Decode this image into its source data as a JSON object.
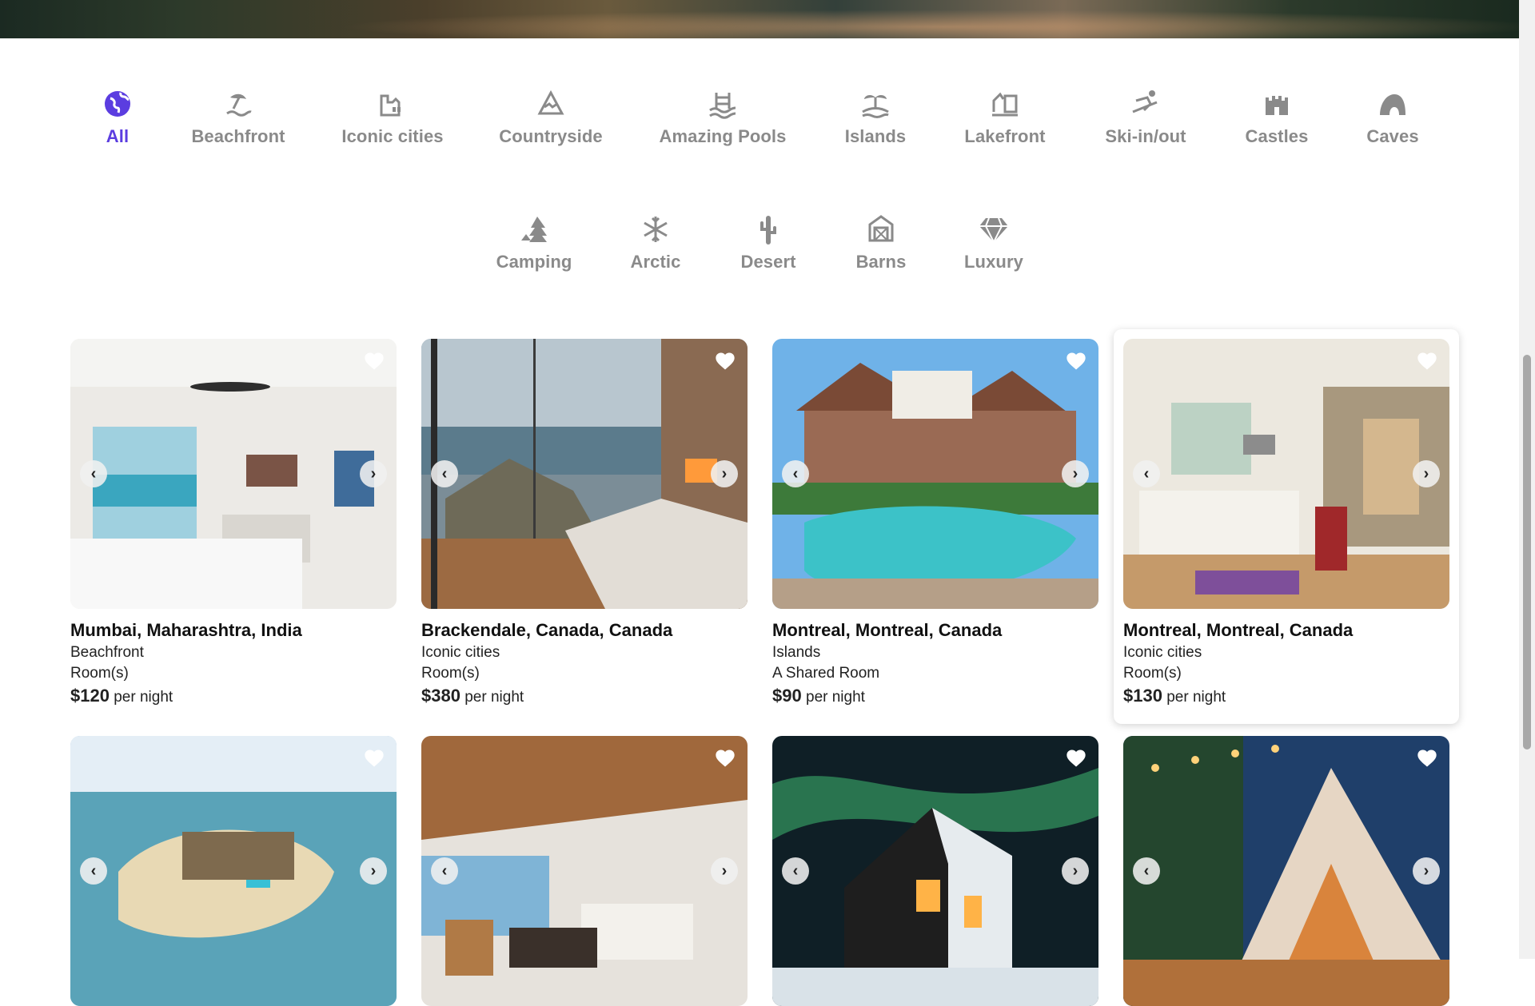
{
  "categories": [
    {
      "label": "All",
      "icon": "globe-icon",
      "active": true
    },
    {
      "label": "Beachfront",
      "icon": "beach-icon"
    },
    {
      "label": "Iconic cities",
      "icon": "city-icon"
    },
    {
      "label": "Countryside",
      "icon": "mountain-icon"
    },
    {
      "label": "Amazing Pools",
      "icon": "pool-icon"
    },
    {
      "label": "Islands",
      "icon": "island-icon"
    },
    {
      "label": "Lakefront",
      "icon": "lake-icon"
    },
    {
      "label": "Ski-in/out",
      "icon": "ski-icon"
    },
    {
      "label": "Castles",
      "icon": "castle-icon"
    },
    {
      "label": "Caves",
      "icon": "cave-icon"
    },
    {
      "label": "Camping",
      "icon": "tent-icon"
    },
    {
      "label": "Arctic",
      "icon": "snowflake-icon"
    },
    {
      "label": "Desert",
      "icon": "cactus-icon"
    },
    {
      "label": "Barns",
      "icon": "barn-icon"
    },
    {
      "label": "Luxury",
      "icon": "diamond-icon"
    }
  ],
  "listings": [
    {
      "title": "Mumbai, Maharashtra, India",
      "category": "Beachfront",
      "room": "Room(s)",
      "price": "$120",
      "price_suffix": "per night",
      "scene": "bedroom-ocean"
    },
    {
      "title": "Brackendale, Canada, Canada",
      "category": "Iconic cities",
      "room": "Room(s)",
      "price": "$380",
      "price_suffix": "per night",
      "scene": "bedroom-cliff"
    },
    {
      "title": "Montreal, Montreal, Canada",
      "category": "Islands",
      "room": "A Shared Room",
      "price": "$90",
      "price_suffix": "per night",
      "scene": "house-pool"
    },
    {
      "title": "Montreal, Montreal, Canada",
      "category": "Iconic cities",
      "room": "Room(s)",
      "price": "$130",
      "price_suffix": "per night",
      "scene": "kitchen"
    },
    {
      "scene": "island-aerial"
    },
    {
      "scene": "living-room-sea"
    },
    {
      "scene": "aurora-cabin"
    },
    {
      "scene": "glamping-tent"
    }
  ],
  "colors": {
    "accent": "#5b3de0",
    "muted": "#8a8a8a"
  },
  "controls": {
    "prev_glyph": "‹",
    "next_glyph": "›"
  }
}
